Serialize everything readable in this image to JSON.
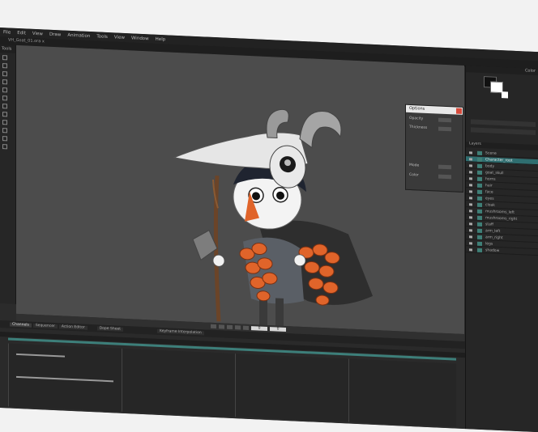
{
  "menu": [
    "File",
    "Edit",
    "View",
    "Draw",
    "Animation",
    "Tools",
    "View",
    "Window",
    "Help"
  ],
  "document_tab": "VH_Goat_01.ora x",
  "tools_panel": {
    "title": "Tools"
  },
  "viewport": {
    "frame_value": "0",
    "end_frame": "0"
  },
  "dialog": {
    "title": "Options",
    "rows": [
      "Opacity",
      "Thickness",
      "Mode",
      "Color"
    ]
  },
  "right_panel": {
    "header": "Color",
    "layers_header": "Layers",
    "layers": [
      "Scene",
      "Character_root",
      "body",
      "goat_skull",
      "horns",
      "hair",
      "face",
      "eyes",
      "cloak",
      "mushrooms_left",
      "mushrooms_right",
      "staff",
      "arm_left",
      "arm_right",
      "legs",
      "shadow"
    ]
  },
  "timeline": {
    "tabs": [
      "Channels",
      "Sequencer",
      "Action Editor",
      "Dope Sheet"
    ],
    "mode_label": "Keyframe Interpolation"
  },
  "colors": {
    "viewport_bg": "#4c4c4c",
    "panel_bg": "#262626",
    "selection": "#2f6e70",
    "accent_orange": "#e0642a",
    "timeline_track": "#3d7f7a"
  }
}
